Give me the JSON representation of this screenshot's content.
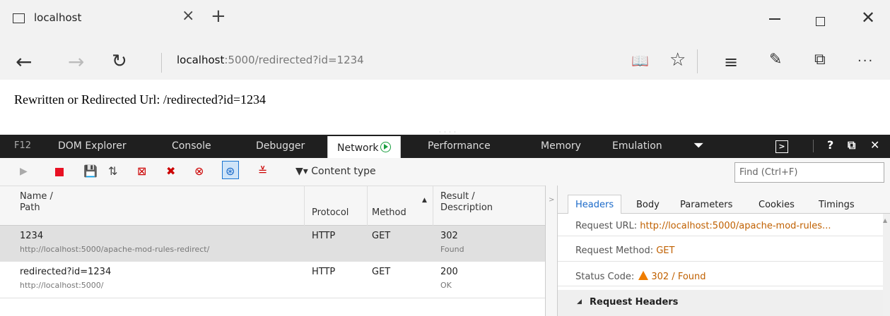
{
  "browser": {
    "tab_title": "localhost",
    "address_host": "localhost",
    "address_rest": ":5000/redirected?id=1234"
  },
  "page": {
    "text": "Rewritten or Redirected Url: /redirected?id=1234"
  },
  "devtools": {
    "tabs": [
      "F12",
      "DOM Explorer",
      "Console",
      "Debugger",
      "Network",
      "Performance",
      "Memory",
      "Emulation"
    ],
    "filter_label": "Content type",
    "find_placeholder": "Find (Ctrl+F)",
    "columns": {
      "name": "Name /",
      "path": "Path",
      "protocol": "Protocol",
      "method": "Method",
      "result": "Result /",
      "description": "Description"
    },
    "requests": [
      {
        "name": "1234",
        "path": "http://localhost:5000/apache-mod-rules-redirect/",
        "protocol": "HTTP",
        "method": "GET",
        "result": "302",
        "description": "Found"
      },
      {
        "name": "redirected?id=1234",
        "path": "http://localhost:5000/",
        "protocol": "HTTP",
        "method": "GET",
        "result": "200",
        "description": "OK"
      }
    ],
    "detail_tabs": [
      "Headers",
      "Body",
      "Parameters",
      "Cookies",
      "Timings"
    ],
    "details": {
      "url_label": "Request URL:",
      "url_value": "http://localhost:5000/apache-mod-rules...",
      "method_label": "Request Method:",
      "method_value": "GET",
      "status_label": "Status Code:",
      "status_value": "302 / Found",
      "section": "Request Headers"
    }
  },
  "colors": {
    "accent": "#1b6ac9",
    "record_stop": "#e81123",
    "value": "#c06000",
    "warning": "#ef7d00"
  }
}
